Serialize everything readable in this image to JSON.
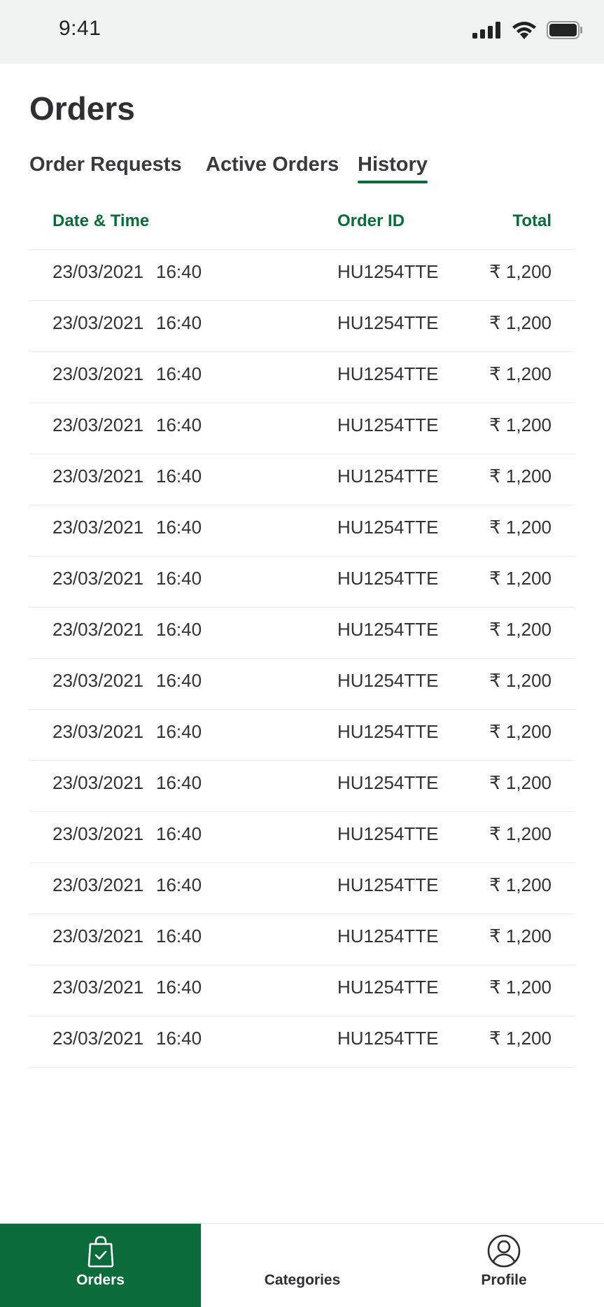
{
  "status_bar": {
    "time": "9:41"
  },
  "page_title": "Orders",
  "tabs": [
    {
      "label": "Order Requests",
      "active": false
    },
    {
      "label": "Active Orders",
      "active": false
    },
    {
      "label": "History",
      "active": true
    }
  ],
  "table": {
    "headers": {
      "datetime": "Date & Time",
      "order_id": "Order ID",
      "total": "Total"
    },
    "rows": [
      {
        "date": "23/03/2021",
        "time": "16:40",
        "order_id": "HU1254TTE",
        "total": "₹ 1,200"
      },
      {
        "date": "23/03/2021",
        "time": "16:40",
        "order_id": "HU1254TTE",
        "total": "₹ 1,200"
      },
      {
        "date": "23/03/2021",
        "time": "16:40",
        "order_id": "HU1254TTE",
        "total": "₹ 1,200"
      },
      {
        "date": "23/03/2021",
        "time": "16:40",
        "order_id": "HU1254TTE",
        "total": "₹ 1,200"
      },
      {
        "date": "23/03/2021",
        "time": "16:40",
        "order_id": "HU1254TTE",
        "total": "₹ 1,200"
      },
      {
        "date": "23/03/2021",
        "time": "16:40",
        "order_id": "HU1254TTE",
        "total": "₹ 1,200"
      },
      {
        "date": "23/03/2021",
        "time": "16:40",
        "order_id": "HU1254TTE",
        "total": "₹ 1,200"
      },
      {
        "date": "23/03/2021",
        "time": "16:40",
        "order_id": "HU1254TTE",
        "total": "₹ 1,200"
      },
      {
        "date": "23/03/2021",
        "time": "16:40",
        "order_id": "HU1254TTE",
        "total": "₹ 1,200"
      },
      {
        "date": "23/03/2021",
        "time": "16:40",
        "order_id": "HU1254TTE",
        "total": "₹ 1,200"
      },
      {
        "date": "23/03/2021",
        "time": "16:40",
        "order_id": "HU1254TTE",
        "total": "₹ 1,200"
      },
      {
        "date": "23/03/2021",
        "time": "16:40",
        "order_id": "HU1254TTE",
        "total": "₹ 1,200"
      },
      {
        "date": "23/03/2021",
        "time": "16:40",
        "order_id": "HU1254TTE",
        "total": "₹ 1,200"
      },
      {
        "date": "23/03/2021",
        "time": "16:40",
        "order_id": "HU1254TTE",
        "total": "₹ 1,200"
      },
      {
        "date": "23/03/2021",
        "time": "16:40",
        "order_id": "HU1254TTE",
        "total": "₹ 1,200"
      },
      {
        "date": "23/03/2021",
        "time": "16:40",
        "order_id": "HU1254TTE",
        "total": "₹ 1,200"
      }
    ]
  },
  "bottom_nav": [
    {
      "label": "Orders",
      "icon": "shopping-bag-check-icon",
      "active": true
    },
    {
      "label": "Categories",
      "icon": "",
      "active": false
    },
    {
      "label": "Profile",
      "icon": "user-circle-icon",
      "active": false
    }
  ],
  "colors": {
    "accent": "#0b6b3a",
    "status_bar_bg": "#f1f2f2",
    "text": "#2f2f33",
    "divider": "#ebebeb"
  }
}
